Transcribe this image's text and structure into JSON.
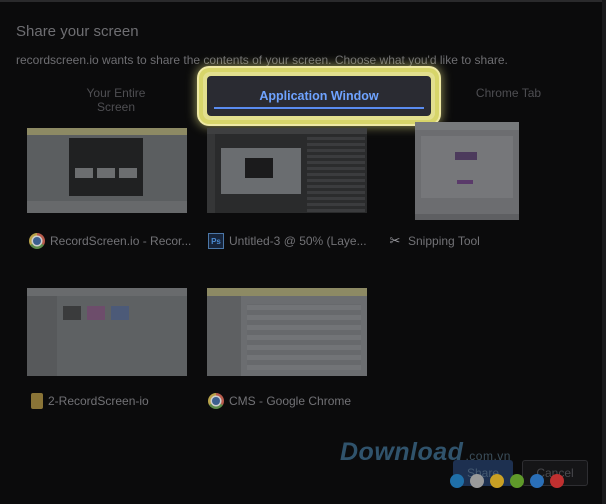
{
  "dialog": {
    "title": "Share your screen",
    "subtitle": "recordscreen.io wants to share the contents of your screen. Choose what you'd like to share."
  },
  "tabs": {
    "entire_screen": "Your Entire Screen",
    "application_window": "Application Window",
    "chrome_tab": "Chrome Tab",
    "active": "application_window"
  },
  "windows": [
    {
      "label": "RecordScreen.io - Recor...",
      "icon": "chrome-icon"
    },
    {
      "label": "Untitled-3 @ 50% (Laye...",
      "icon": "photoshop-icon",
      "icon_text": "Ps"
    },
    {
      "label": "Snipping Tool",
      "icon": "scissors-icon"
    },
    {
      "label": "2-RecordScreen-io",
      "icon": "folder-icon"
    },
    {
      "label": "CMS - Google Chrome",
      "icon": "chrome-icon"
    }
  ],
  "buttons": {
    "share": "Share",
    "cancel": "Cancel"
  },
  "watermark": {
    "brand": "Download",
    "suffix": ".com.vn",
    "dot_colors": [
      "#1f6fa8",
      "#9a9a9a",
      "#c9a024",
      "#5f9a2a",
      "#2a6fb8",
      "#c03030"
    ]
  },
  "colors": {
    "accent": "#6fa3ff",
    "highlight": "#e2df8e",
    "background": "#0b0b0c"
  }
}
